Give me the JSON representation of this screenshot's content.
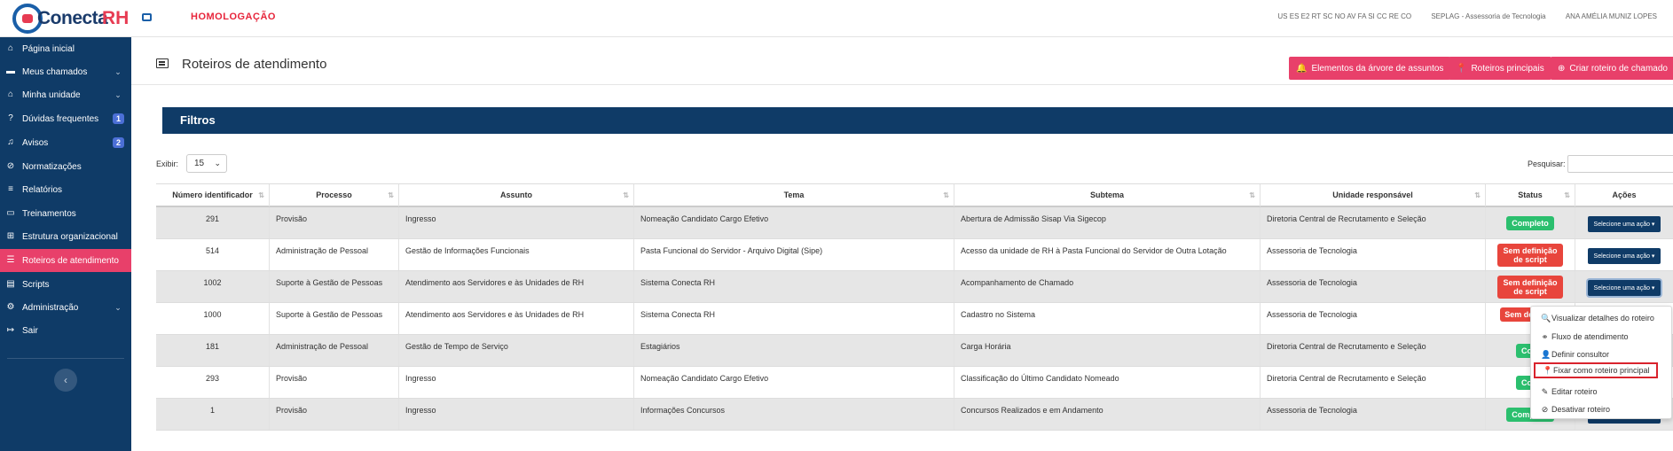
{
  "header": {
    "logo_part1": "Conecta",
    "logo_part2": "RH",
    "environment": "HOMOLOGAÇÃO",
    "states": "US ES E2 RT SC NO AV FA SI CC RE CO",
    "org": "SEPLAG - Assessoria de Tecnologia",
    "user": "ANA AMÉLIA MUNIZ LOPES"
  },
  "sidebar": {
    "items": [
      {
        "label": "Página inicial",
        "icon": "home-icon"
      },
      {
        "label": "Meus chamados",
        "icon": "ticket-icon",
        "chevron": "⌄"
      },
      {
        "label": "Minha unidade",
        "icon": "building-icon",
        "chevron": "⌄"
      },
      {
        "label": "Dúvidas frequentes",
        "icon": "question-icon",
        "badge": "1"
      },
      {
        "label": "Avisos",
        "icon": "bell-icon",
        "badge": "2"
      },
      {
        "label": "Normatizações",
        "icon": "compass-icon"
      },
      {
        "label": "Relatórios",
        "icon": "list-icon"
      },
      {
        "label": "Treinamentos",
        "icon": "training-icon"
      },
      {
        "label": "Estrutura organizacional",
        "icon": "sitemap-icon"
      },
      {
        "label": "Roteiros de atendimento",
        "icon": "list-alt-icon"
      },
      {
        "label": "Scripts",
        "icon": "file-icon"
      },
      {
        "label": "Administração",
        "icon": "cogs-icon",
        "chevron": "⌄"
      },
      {
        "label": "Sair",
        "icon": "sign-out-icon"
      }
    ],
    "collapse": "‹"
  },
  "page": {
    "title": "Roteiros de atendimento",
    "buttons": {
      "elementos": "Elementos da árvore de assuntos",
      "principais": "Roteiros principais",
      "criar": "Criar roteiro de chamado"
    },
    "filters": "Filtros",
    "show_label": "Exibir:",
    "show_value": "15",
    "search_label": "Pesquisar:"
  },
  "table": {
    "headers": [
      "Número identificador",
      "Processo",
      "Assunto",
      "Tema",
      "Subtema",
      "Unidade responsável",
      "Status",
      "Ações"
    ],
    "action_label": "Selecione uma ação",
    "rows": [
      {
        "id": "291",
        "processo": "Provisão",
        "assunto": "Ingresso",
        "tema": "Nomeação Candidato Cargo Efetivo",
        "subtema": "Abertura de Admissão Sisap Via Sigecop",
        "unidade": "Diretoria Central de Recrutamento e Seleção",
        "status": "Completo",
        "status_type": "ok"
      },
      {
        "id": "514",
        "processo": "Administração de Pessoal",
        "assunto": "Gestão de Informações Funcionais",
        "tema": "Pasta Funcional do Servidor - Arquivo Digital (Sipe)",
        "subtema": "Acesso da unidade de RH à Pasta Funcional do Servidor de Outra Lotação",
        "unidade": "Assessoria de Tecnologia",
        "status": "Sem definição de script",
        "status_type": "nok"
      },
      {
        "id": "1002",
        "processo": "Suporte à Gestão de Pessoas",
        "assunto": "Atendimento aos Servidores e às Unidades de RH",
        "tema": "Sistema Conecta RH",
        "subtema": "Acompanhamento de Chamado",
        "unidade": "Assessoria de Tecnologia",
        "status": "Sem definição de script",
        "status_type": "nok"
      },
      {
        "id": "1000",
        "processo": "Suporte à Gestão de Pessoas",
        "assunto": "Atendimento aos Servidores e às Unidades de RH",
        "tema": "Sistema Conecta RH",
        "subtema": "Cadastro no Sistema",
        "unidade": "Assessoria de Tecnologia",
        "status": "Sem de de sc",
        "status_type": "nok"
      },
      {
        "id": "181",
        "processo": "Administração de Pessoal",
        "assunto": "Gestão de Tempo de Serviço",
        "tema": "Estagiários",
        "subtema": "Carga Horária",
        "unidade": "Diretoria Central de Recrutamento e Seleção",
        "status": "Com",
        "status_type": "ok"
      },
      {
        "id": "293",
        "processo": "Provisão",
        "assunto": "Ingresso",
        "tema": "Nomeação Candidato Cargo Efetivo",
        "subtema": "Classificação do Último Candidato Nomeado",
        "unidade": "Diretoria Central de Recrutamento e Seleção",
        "status": "Com",
        "status_type": "ok"
      },
      {
        "id": "1",
        "processo": "Provisão",
        "assunto": "Ingresso",
        "tema": "Informações Concursos",
        "subtema": "Concursos Realizados e em Andamento",
        "unidade": "Assessoria de Tecnologia",
        "status": "Completo",
        "status_type": "ok"
      }
    ]
  },
  "menu": {
    "items": [
      {
        "label": "Visualizar detalhes do roteiro",
        "icon": "search-icon",
        "glyph": "🔍"
      },
      {
        "label": "Fluxo de atendimento",
        "icon": "flow-icon",
        "glyph": "⚭"
      },
      {
        "label": "Definir consultor",
        "icon": "user-icon",
        "glyph": "👤"
      },
      {
        "label": "Fixar como roteiro principal",
        "icon": "pin-icon",
        "glyph": "📍"
      },
      {
        "label": "Editar roteiro",
        "icon": "pencil-icon",
        "glyph": "✎"
      },
      {
        "label": "Desativar roteiro",
        "icon": "ban-icon",
        "glyph": "⊘"
      }
    ]
  },
  "colors": {
    "primary": "#0f3b67",
    "accent": "#e8406a",
    "success": "#2bbf6e",
    "danger": "#e8453c"
  }
}
